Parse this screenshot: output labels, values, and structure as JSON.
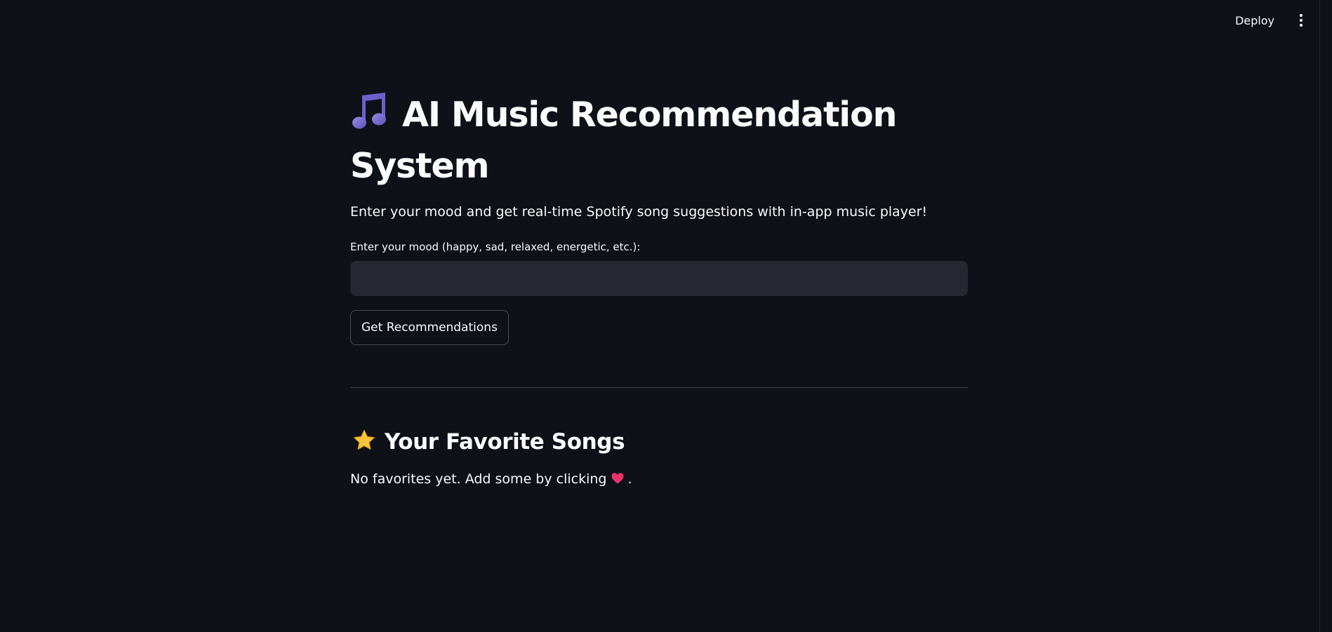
{
  "header": {
    "deploy_label": "Deploy"
  },
  "main": {
    "title": "AI Music Recommendation System",
    "subtitle": "Enter your mood and get real-time Spotify song suggestions with in-app music player!",
    "mood_input": {
      "label": "Enter your mood (happy, sad, relaxed, energetic, etc.):",
      "value": "",
      "placeholder": ""
    },
    "recommend_button_label": "Get Recommendations"
  },
  "favorites": {
    "title": "Your Favorite Songs",
    "empty_text_before": "No favorites yet. Add some by clicking",
    "empty_text_after": "."
  },
  "icons": {
    "title": "music-notes-icon",
    "favorites": "star-icon",
    "heart": "heart-icon",
    "menu": "more-vertical-icon"
  },
  "colors": {
    "background": "#0e1117",
    "input_background": "#262730",
    "text": "#fafafa",
    "music_icon": "#7b6ad6",
    "star": "#f8c53a",
    "heart": "#e8336b"
  }
}
